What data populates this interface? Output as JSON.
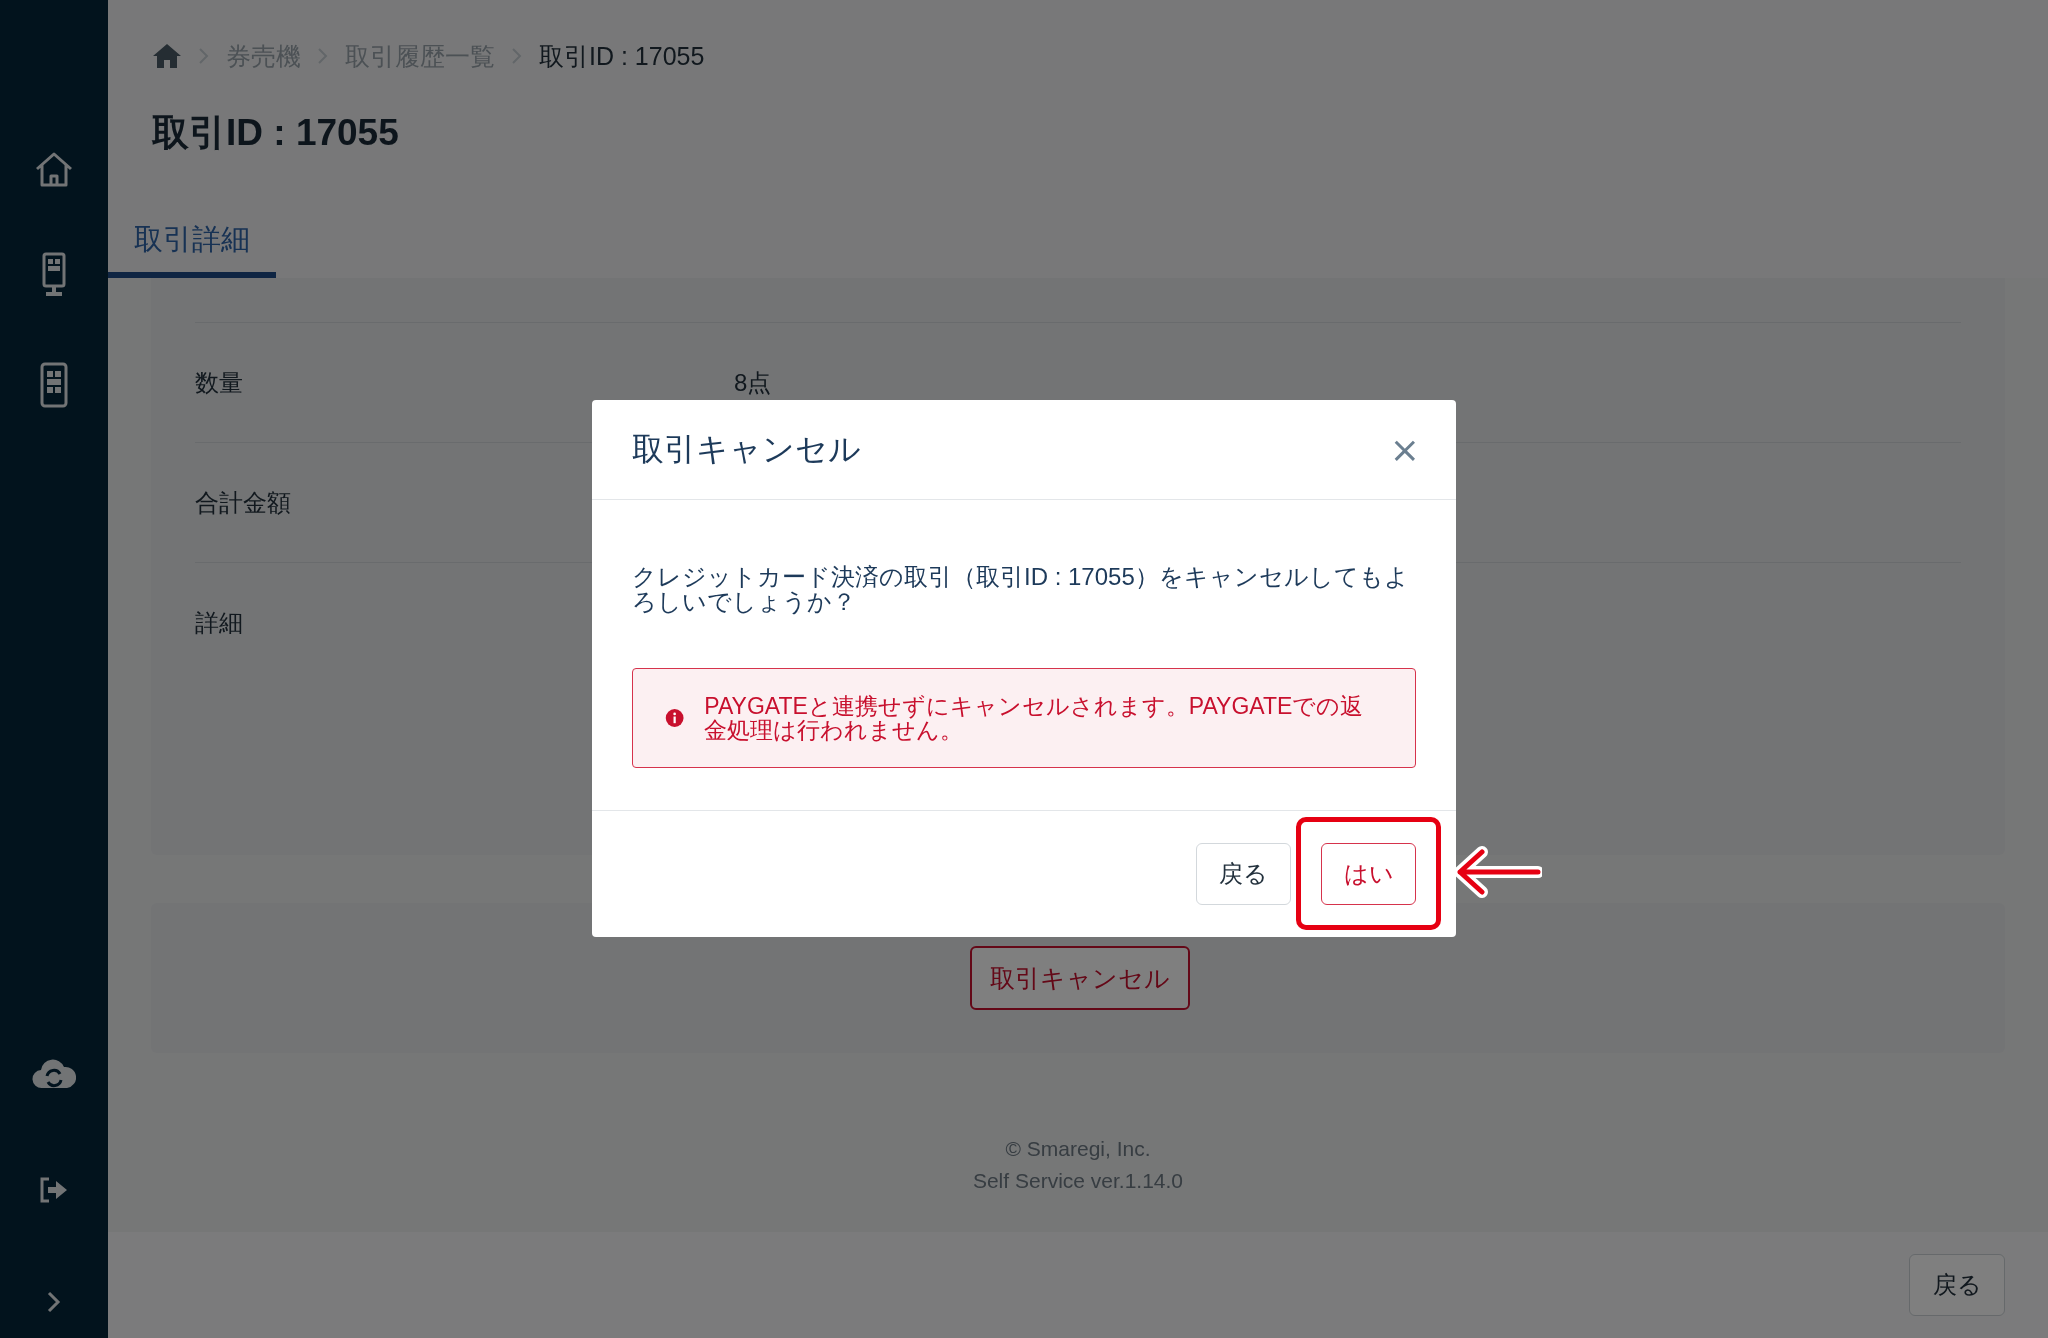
{
  "breadcrumb": [
    {
      "label": "券売機",
      "current": false
    },
    {
      "label": "取引履歴一覧",
      "current": false
    },
    {
      "label": "取引ID : 17055",
      "current": true
    }
  ],
  "page_title": "取引ID : 17055",
  "tabs": [
    {
      "label": "取引詳細",
      "selected": true
    }
  ],
  "details": [
    {
      "label": "数量",
      "value": "8点"
    },
    {
      "label": "合計金額"
    },
    {
      "label": "詳細"
    }
  ],
  "cancel_button": "取引キャンセル",
  "footer": {
    "copyright": "© Smaregi, Inc.",
    "version": "Self Service ver.1.14.0"
  },
  "bottom_bar": {
    "back_button": "戻る"
  },
  "dialog": {
    "title": "取引キャンセル",
    "close": "×",
    "message": "クレジットカード決済の取引（取引ID : 17055）をキャンセルしてもよろしいでしょうか？",
    "alert": {
      "kind": "danger",
      "text": "PAYGATEと連携せずにキャンセルされます。PAYGATEでの返金処理は行われません。"
    },
    "buttons": [
      {
        "label": "戻る",
        "kind": "secondary"
      },
      {
        "label": "はい",
        "kind": "danger"
      }
    ]
  }
}
